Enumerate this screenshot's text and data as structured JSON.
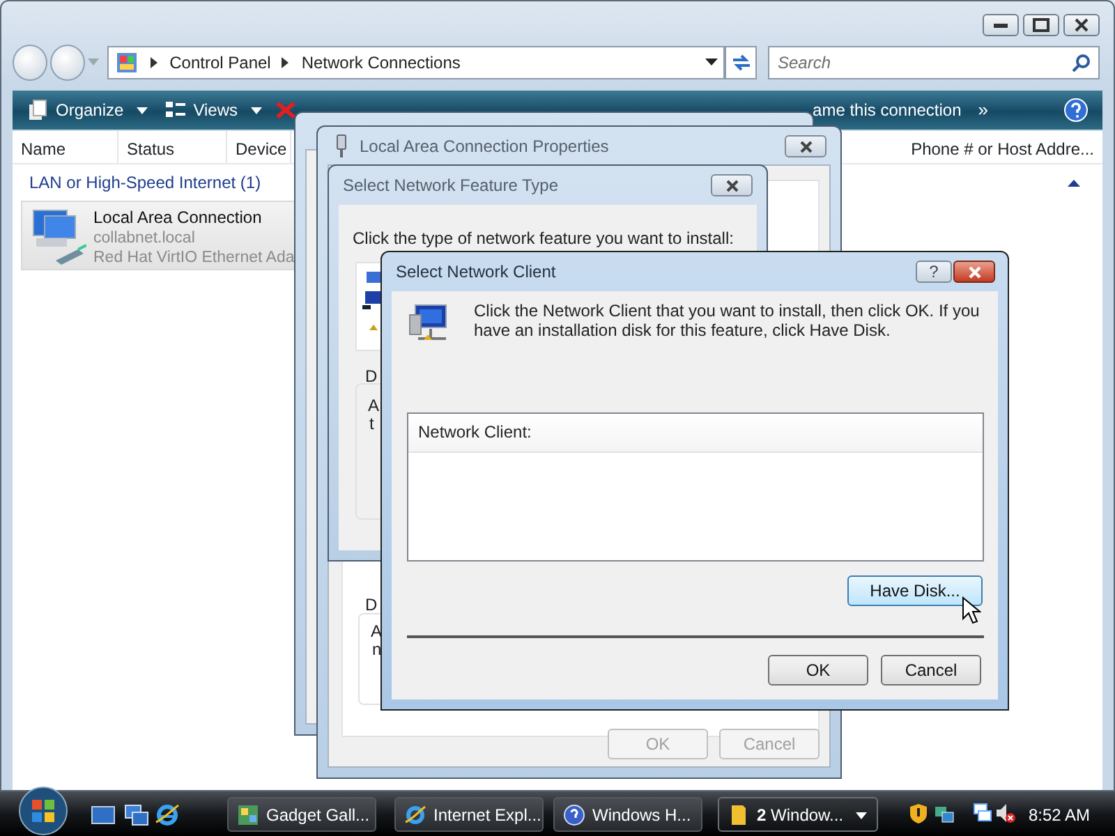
{
  "explorer": {
    "address": [
      "Control Panel",
      "Network Connections"
    ],
    "search": {
      "placeholder": "Search"
    },
    "toolbar": [
      {
        "label": "Organize",
        "dropdown": true
      },
      {
        "label": "Views",
        "dropdown": true
      },
      {
        "label": "ame this connection",
        "dropdown": false
      }
    ],
    "more": "»",
    "columns": [
      "Name",
      "Status",
      "Device",
      "Phone # or Host Addre..."
    ],
    "group": "LAN or High-Speed Internet (1)",
    "items": [
      {
        "name": "Local Area Connection",
        "lines": [
          "collabnet.local",
          "Red Hat VirtIO Ethernet Ada"
        ]
      }
    ]
  },
  "properties_dialog": {
    "title": "Local Area Connection Properties",
    "fragments": [
      "D",
      "A",
      "n"
    ],
    "buttons": [
      {
        "label": "OK",
        "disabled": true
      },
      {
        "label": "Cancel",
        "disabled": true
      }
    ]
  },
  "feature_dialog": {
    "title": "Select Network Feature Type",
    "prompt": "Click the type of network feature you want to install:",
    "fragments": [
      "D",
      "A",
      "t"
    ]
  },
  "client_dialog": {
    "title": "Select Network Client",
    "help": "?",
    "message": "Click the Network Client that you want to install, then click OK. If you have an installation disk for this feature, click Have Disk.",
    "list_header": "Network Client:",
    "have_disk": "Have Disk...",
    "buttons": [
      {
        "label": "OK"
      },
      {
        "label": "Cancel"
      }
    ]
  },
  "taskbar": {
    "tasks": [
      {
        "label": "Gadget Gall...",
        "selected": false,
        "grouped": false
      },
      {
        "label": "Internet Expl...",
        "selected": false,
        "grouped": false
      },
      {
        "label": "Windows H...",
        "selected": false,
        "grouped": false
      },
      {
        "label": "**2** Window...",
        "selected": true,
        "grouped": true
      }
    ],
    "clock": "8:52 AM"
  }
}
